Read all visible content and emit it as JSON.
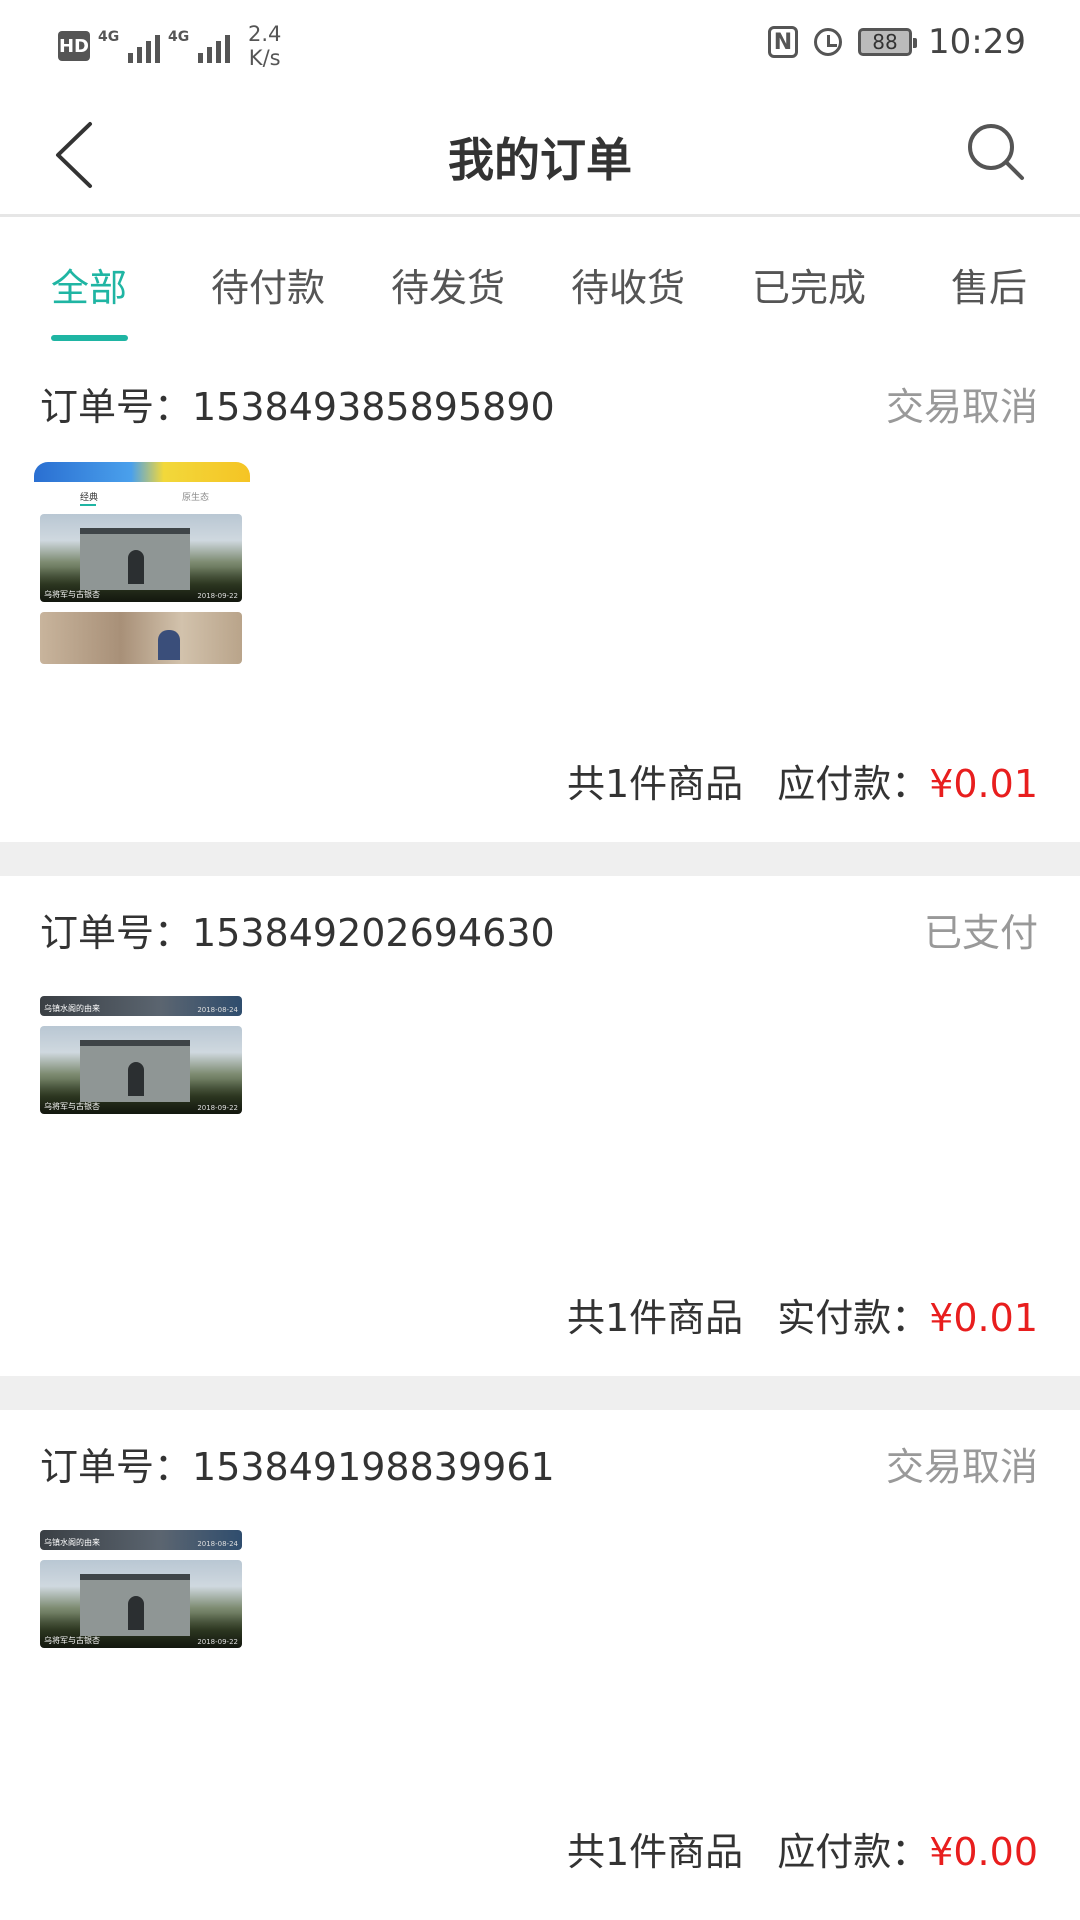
{
  "status_bar": {
    "hd": "HD",
    "net1": "4G",
    "net2": "4G",
    "speed_value": "2.4",
    "speed_unit": "K/s",
    "nfc": "N",
    "battery": "88",
    "time": "10:29"
  },
  "header": {
    "title": "我的订单"
  },
  "tabs": [
    {
      "label": "全部",
      "active": true
    },
    {
      "label": "待付款"
    },
    {
      "label": "待发货"
    },
    {
      "label": "待收货"
    },
    {
      "label": "已完成"
    },
    {
      "label": "售后"
    }
  ],
  "orders": [
    {
      "order_no_label": "订单号：",
      "order_no": "153849385895890",
      "status": "交易取消",
      "thumb": {
        "tab1": "经典",
        "tab2": "原生态",
        "caption": "乌将军与古银杏",
        "date": "2018-09-22"
      },
      "count_text": "共1件商品",
      "pay_label": "应付款：",
      "amount": "¥0.01"
    },
    {
      "order_no_label": "订单号：",
      "order_no": "153849202694630",
      "status": "已支付",
      "thumb": {
        "strip_caption": "乌镇水阁的由来",
        "strip_date": "2018-08-24",
        "caption": "乌将军与古银杏",
        "date": "2018-09-22"
      },
      "count_text": "共1件商品",
      "pay_label": "实付款：",
      "amount": "¥0.01"
    },
    {
      "order_no_label": "订单号：",
      "order_no": "153849198839961",
      "status": "交易取消",
      "thumb": {
        "strip_caption": "乌镇水阁的由来",
        "strip_date": "2018-08-24",
        "caption": "乌将军与古银杏",
        "date": "2018-09-22"
      },
      "count_text": "共1件商品",
      "pay_label": "应付款：",
      "amount": "¥0.00"
    }
  ],
  "colors": {
    "accent": "#1fb5a3",
    "price": "#e81e1e",
    "muted": "#999999"
  }
}
